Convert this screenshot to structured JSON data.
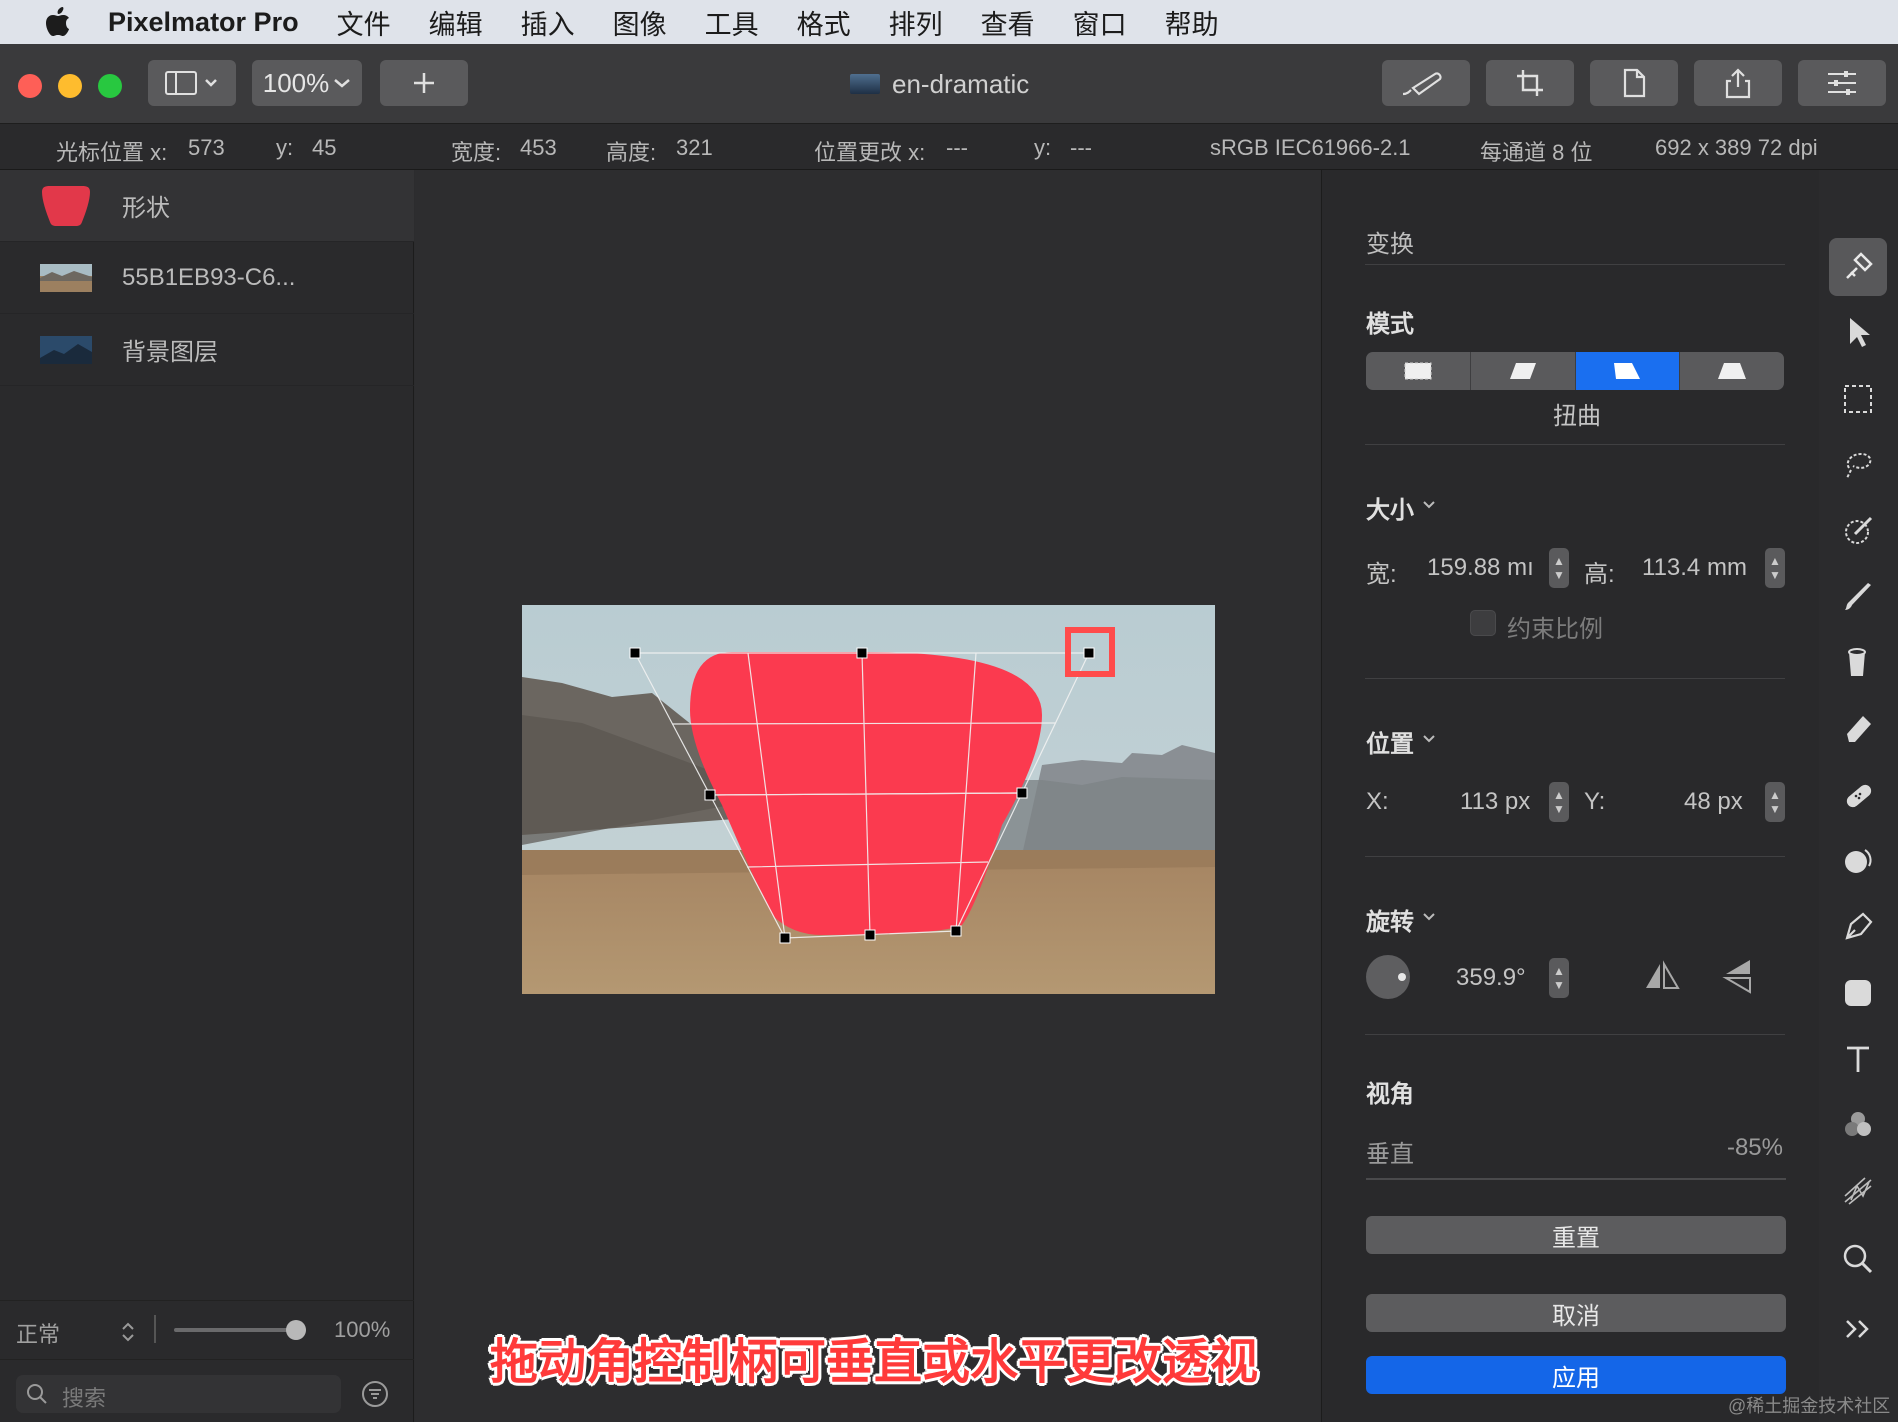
{
  "menubar": {
    "app_name": "Pixelmator Pro",
    "items": [
      "文件",
      "编辑",
      "插入",
      "图像",
      "工具",
      "格式",
      "排列",
      "查看",
      "窗口",
      "帮助"
    ]
  },
  "toolbar": {
    "zoom": "100%",
    "doc_title": "en-dramatic"
  },
  "infobar": {
    "cursor_label": "光标位置 x:",
    "cursor_x": "573",
    "cursor_y_label": "y:",
    "cursor_y": "45",
    "width_label": "宽度:",
    "width_val": "453",
    "height_label": "高度:",
    "height_val": "321",
    "pos_change_label": "位置更改 x:",
    "pos_change_x": "---",
    "pos_change_y_label": "y:",
    "pos_change_y": "---",
    "color_profile": "sRGB IEC61966-2.1",
    "bit_depth": "每通道 8 位",
    "dimensions": "692 x 389 72 dpi"
  },
  "layers": {
    "items": [
      {
        "name": "形状"
      },
      {
        "name": "55B1EB93-C6..."
      },
      {
        "name": "背景图层"
      }
    ],
    "blend_mode": "正常",
    "opacity": "100%",
    "opacity_level": 1.0,
    "search_placeholder": "搜索"
  },
  "inspector": {
    "title": "变换",
    "mode_label": "模式",
    "mode_active_label": "扭曲",
    "size_label": "大小",
    "width_label": "宽:",
    "width_value": "159.88 mı",
    "height_label": "高:",
    "height_value": "113.4 mm",
    "constrain_label": "约束比例",
    "position_label": "位置",
    "x_label": "X:",
    "x_value": "113 px",
    "y_label": "Y:",
    "y_value": "48 px",
    "rotation_label": "旋转",
    "rotation_value": "359.9°",
    "perspective_label": "视角",
    "vertical_label": "垂直",
    "vertical_value": "-85%",
    "reset_label": "重置",
    "cancel_label": "取消",
    "apply_label": "应用"
  },
  "caption": "拖动角控制柄可垂直或水平更改透视",
  "watermark": "@稀土掘金技术社区",
  "colors": {
    "accent_blue": "#1a6ff0",
    "shape_red": "#fb3a4f",
    "highlight_red": "#ff4b4b"
  },
  "tools": [
    "style-icon",
    "arrange-icon",
    "select-icon",
    "lasso-icon",
    "magic-wand-icon",
    "paint-icon",
    "fill-icon",
    "eraser-icon",
    "repair-icon",
    "color-adjust-icon",
    "pen-icon",
    "shape-icon",
    "type-icon",
    "effects-icon",
    "distort-icon",
    "zoom-icon",
    "more-icon"
  ]
}
